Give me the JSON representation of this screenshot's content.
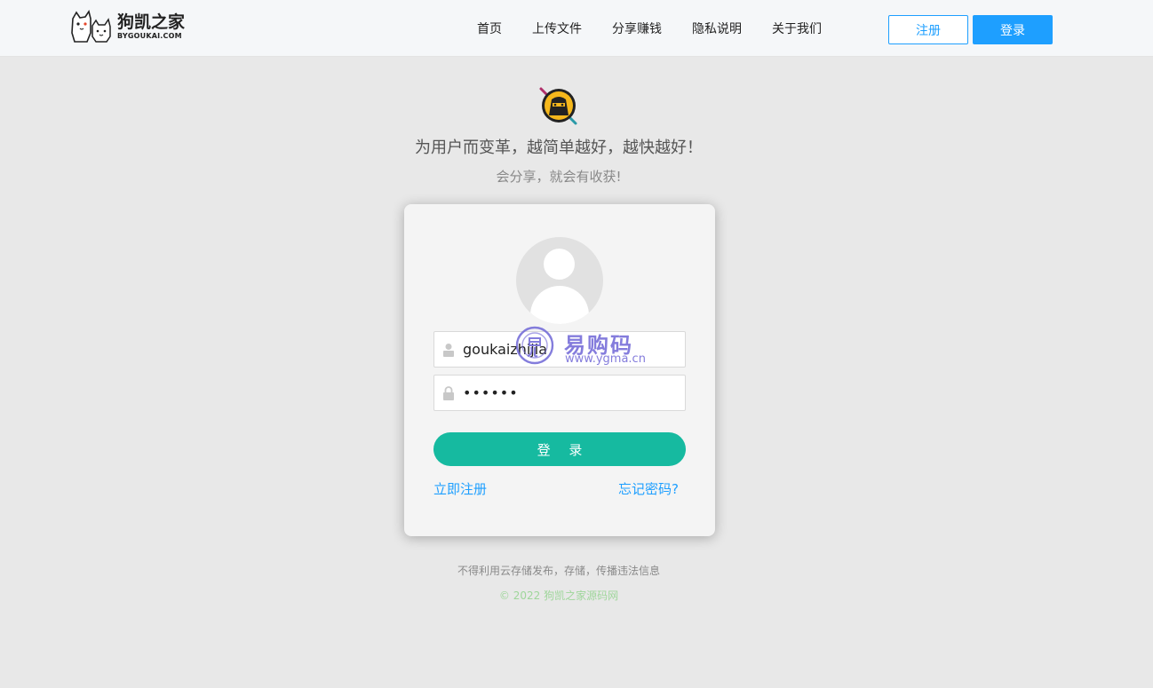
{
  "header": {
    "logo_title": "狗凯之家",
    "logo_sub": "BYGOUKAI.COM",
    "nav": [
      "首页",
      "上传文件",
      "分享赚钱",
      "隐私说明",
      "关于我们"
    ],
    "register_label": "注册",
    "login_label": "登录"
  },
  "hero": {
    "title": "为用户而变革，越简单越好，越快越好！",
    "subtitle": "会分享，就会有收获!"
  },
  "login_form": {
    "username_value": "goukaizhijia",
    "password_value": "••••••",
    "submit_label": "登 录",
    "register_link": "立即注册",
    "forgot_link": "忘记密码?"
  },
  "watermark": {
    "brand": "易购码",
    "url": "www.ygma.cn"
  },
  "footer": {
    "note": "不得利用云存储发布，存储，传播违法信息",
    "copyright": "© 2022 狗凯之家源码网"
  },
  "colors": {
    "primary_blue": "#1e9fff",
    "login_green": "#16baa0",
    "footer_green": "#9fd69b",
    "watermark_purple": "#6f66d6"
  },
  "icons": {
    "username": "user-icon",
    "password": "lock-icon",
    "avatar": "default-avatar-icon"
  }
}
